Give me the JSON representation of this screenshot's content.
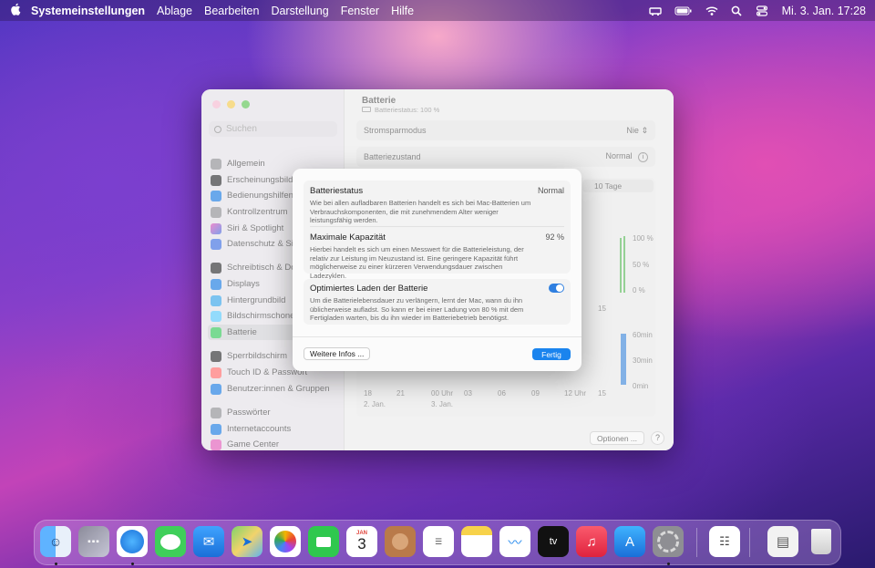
{
  "menubar": {
    "app": "Systemeinstellungen",
    "menus": [
      "Ablage",
      "Bearbeiten",
      "Darstellung",
      "Fenster",
      "Hilfe"
    ],
    "clock": "Mi. 3. Jan.  17:28"
  },
  "window": {
    "search_placeholder": "Suchen",
    "sidebar_items": [
      {
        "label": "Allgemein",
        "color": "#8e8e93"
      },
      {
        "label": "Erscheinungsbild",
        "color": "#2c2c2e"
      },
      {
        "label": "Bedienungshilfen",
        "color": "#1a7ae0"
      },
      {
        "label": "Kontrollzentrum",
        "color": "#8e8e93"
      },
      {
        "label": "Siri & Spotlight",
        "color": "#c43ad6"
      },
      {
        "label": "Datenschutz & Sicherheit",
        "color": "#3d6ee0"
      },
      {
        "label": "Schreibtisch & Dock",
        "color": "#2c2c2e"
      },
      {
        "label": "Displays",
        "color": "#1a7ae0"
      },
      {
        "label": "Hintergrundbild",
        "color": "#36a3e8"
      },
      {
        "label": "Bildschirmschoner",
        "color": "#5ac8fa"
      },
      {
        "label": "Batterie",
        "color": "#34c759"
      },
      {
        "label": "Sperrbildschirm",
        "color": "#2c2c2e"
      },
      {
        "label": "Touch ID & Passwort",
        "color": "#ff6b6b"
      },
      {
        "label": "Benutzer:innen & Gruppen",
        "color": "#1a7ae0"
      },
      {
        "label": "Passwörter",
        "color": "#8e8e93"
      },
      {
        "label": "Internetaccounts",
        "color": "#1a7ae0"
      },
      {
        "label": "Game Center",
        "color": "#e05cb8"
      }
    ],
    "main": {
      "title": "Batterie",
      "subtitle": "Batteriestatus: 100 %",
      "stromsparmodus_label": "Stromsparmodus",
      "stromsparmodus_value": "Nie",
      "batteriezustand_label": "Batteriezustand",
      "batteriezustand_value": "Normal",
      "range_tab": "10 Tage",
      "y_labels_top": [
        "100 %",
        "50 %",
        "0 %"
      ],
      "y_labels_bottom": [
        "60min",
        "30min",
        "0min"
      ],
      "x_labels_top": [
        "15"
      ],
      "x_labels_bottom": [
        "18",
        "21",
        "00 Uhr",
        "03",
        "06",
        "09",
        "12 Uhr",
        "15"
      ],
      "date_labels": [
        "2. Jan.",
        "3. Jan."
      ],
      "options_button": "Optionen ...",
      "help_button": "?"
    }
  },
  "sheet": {
    "status_title": "Batteriestatus",
    "status_value": "Normal",
    "status_desc": "Wie bei allen aufladbaren Batterien handelt es sich bei Mac-Batterien um Verbrauchskomponenten, die mit zunehmendem Alter weniger leistungsfähig werden.",
    "capacity_title": "Maximale Kapazität",
    "capacity_value": "92 %",
    "capacity_desc": "Hierbei handelt es sich um einen Messwert für die Batterieleistung, der relativ zur Leistung im Neuzustand ist. Eine geringere Kapazität führt möglicherweise zu einer kürzeren Verwendungsdauer zwischen Ladezyklen.",
    "optimized_title": "Optimiertes Laden der Batterie",
    "optimized_desc": "Um die Batterielebensdauer zu verlängern, lernt der Mac, wann du ihn üblicherweise aufladst. So kann er bei einer Ladung von 80 % mit dem Fertigladen warten, bis du ihn wieder im Batteriebetrieb benötigst.",
    "optimized_on": true,
    "more_button": "Weitere Infos ...",
    "done_button": "Fertig"
  },
  "dock": {
    "calendar_month": "JAN",
    "calendar_day": "3",
    "tv_label": "tv"
  }
}
